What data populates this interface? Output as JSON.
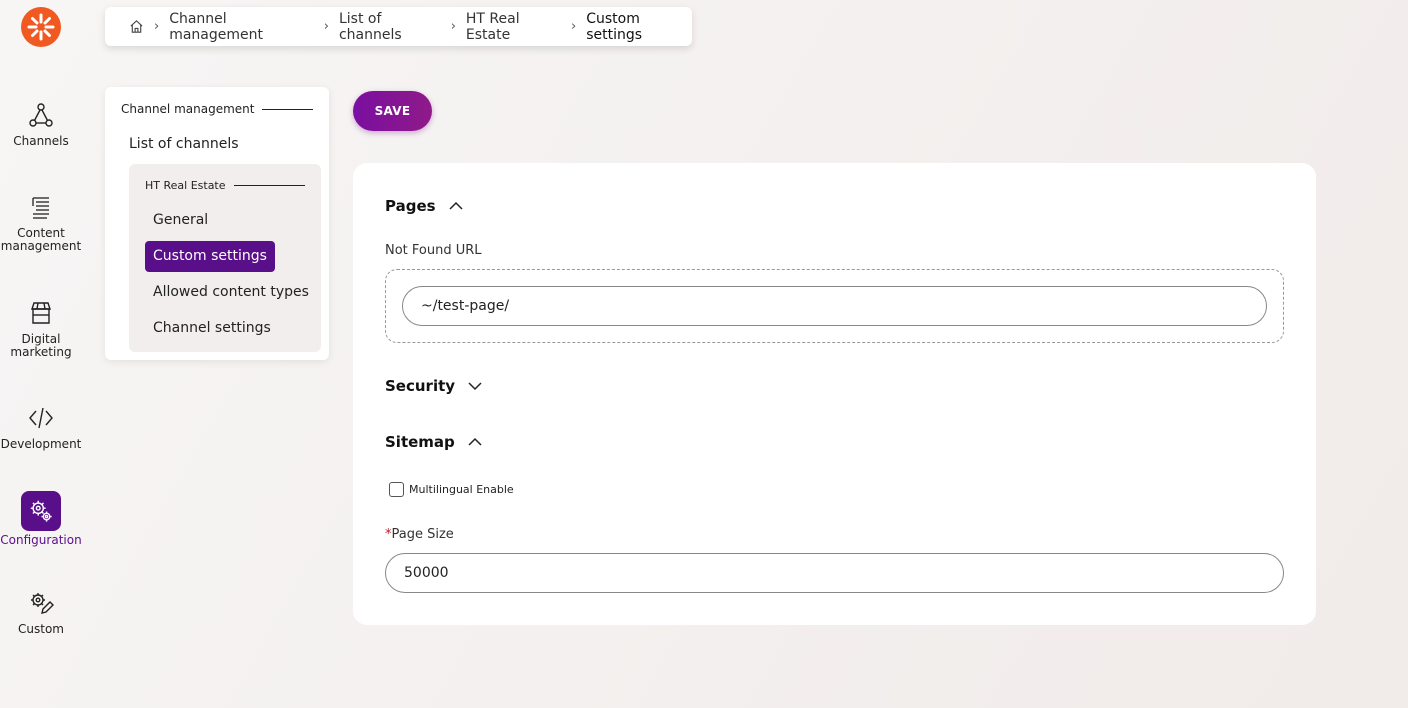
{
  "rail": {
    "items": [
      {
        "label": "Channels",
        "icon": "channels-icon"
      },
      {
        "label": "Content management",
        "icon": "content-management-icon"
      },
      {
        "label": "Digital marketing",
        "icon": "storefront-icon"
      },
      {
        "label": "Development",
        "icon": "code-icon"
      },
      {
        "label": "Configuration",
        "icon": "gears-icon",
        "active": true
      },
      {
        "label": "Custom",
        "icon": "custom-icon"
      }
    ]
  },
  "breadcrumb": {
    "items": [
      "Channel management",
      "List of channels",
      "HT Real Estate",
      "Custom settings"
    ]
  },
  "subnav": {
    "group_title": "Channel management",
    "list_link": "List of channels",
    "channel_title": "HT Real Estate",
    "items": [
      "General",
      "Custom settings",
      "Allowed content types",
      "Channel settings"
    ],
    "active_index": 1
  },
  "toolbar": {
    "save_label": "SAVE"
  },
  "form": {
    "pages": {
      "title": "Pages",
      "expanded": true,
      "not_found_label": "Not Found URL",
      "not_found_value": "~/test-page/"
    },
    "security": {
      "title": "Security",
      "expanded": false
    },
    "sitemap": {
      "title": "Sitemap",
      "expanded": true,
      "multilingual_label": "Multilingual Enable",
      "multilingual_checked": false,
      "page_size_required_mark": "*",
      "page_size_label": "Page Size",
      "page_size_value": "50000"
    }
  },
  "colors": {
    "accent": "#5a0f8a",
    "logo": "#f05a22",
    "required": "#c0182a"
  }
}
